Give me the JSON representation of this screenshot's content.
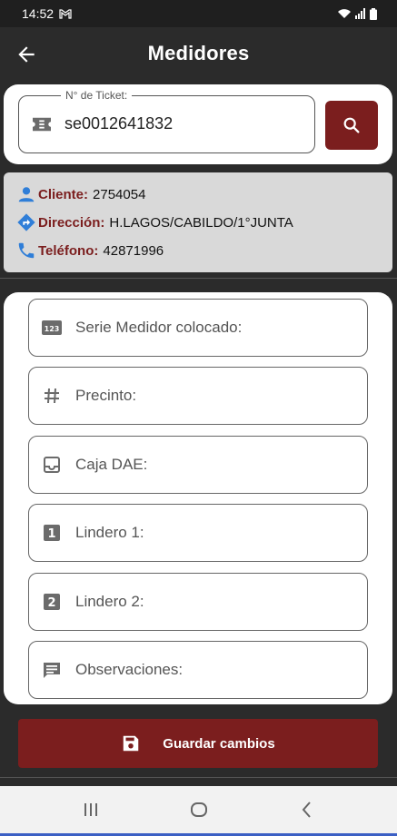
{
  "status": {
    "time": "14:52",
    "notification_icon": "gmail-icon"
  },
  "app_bar": {
    "title": "Medidores",
    "back_icon": "arrow-left-icon"
  },
  "ticket": {
    "label": "N° de Ticket:",
    "value": "se0012641832",
    "icon": "ticket-icon",
    "search_icon": "search-icon"
  },
  "info": {
    "client_label": "Cliente:",
    "client_value": "2754054",
    "address_label": "Dirección:",
    "address_value": "H.LAGOS/CABILDO/1°JUNTA",
    "phone_label": "Teléfono:",
    "phone_value": "42871996"
  },
  "form": {
    "fields": [
      {
        "placeholder": "Serie Medidor colocado:",
        "icon": "numbers-123-icon"
      },
      {
        "placeholder": "Precinto:",
        "icon": "hash-icon"
      },
      {
        "placeholder": "Caja DAE:",
        "icon": "inbox-icon"
      },
      {
        "placeholder": "Lindero 1:",
        "icon": "looks-one-icon"
      },
      {
        "placeholder": "Lindero 2:",
        "icon": "looks-two-icon"
      },
      {
        "placeholder": "Observaciones:",
        "icon": "comment-icon"
      }
    ]
  },
  "save_button": {
    "label": "Guardar cambios",
    "icon": "save-icon"
  },
  "colors": {
    "accent": "#7b1e1e",
    "app_bar": "#2b2b2b",
    "info_bg": "#d9d9d9"
  }
}
